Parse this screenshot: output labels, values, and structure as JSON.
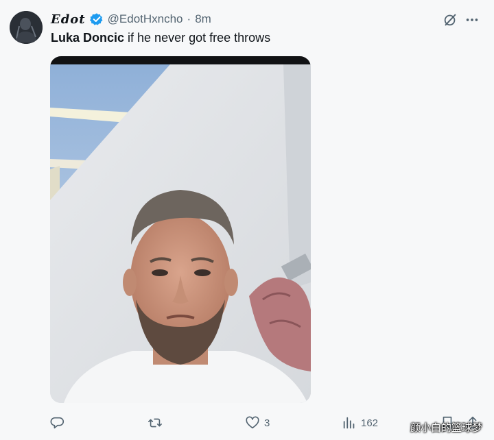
{
  "author": {
    "display_name": "Edot",
    "handle": "@EdotHxncho",
    "separator": "·",
    "time": "8m",
    "verified": true,
    "avatar_icon": "avatar-image"
  },
  "post": {
    "bold_text": "Luka Doncic",
    "rest_text": " if he never got free throws",
    "media_description_icon": "selfie-photo"
  },
  "top_icons": [
    "grok-icon",
    "more-icon"
  ],
  "actions": {
    "reply_count": "",
    "retweet_count": "",
    "like_count": "3",
    "views_count": "162"
  },
  "watermark": "颜小白的篮球梦",
  "colors": {
    "verified_blue": "#1d9bf0",
    "muted_text": "#536471",
    "primary_text": "#0f1419",
    "background": "#f7f8f9"
  }
}
